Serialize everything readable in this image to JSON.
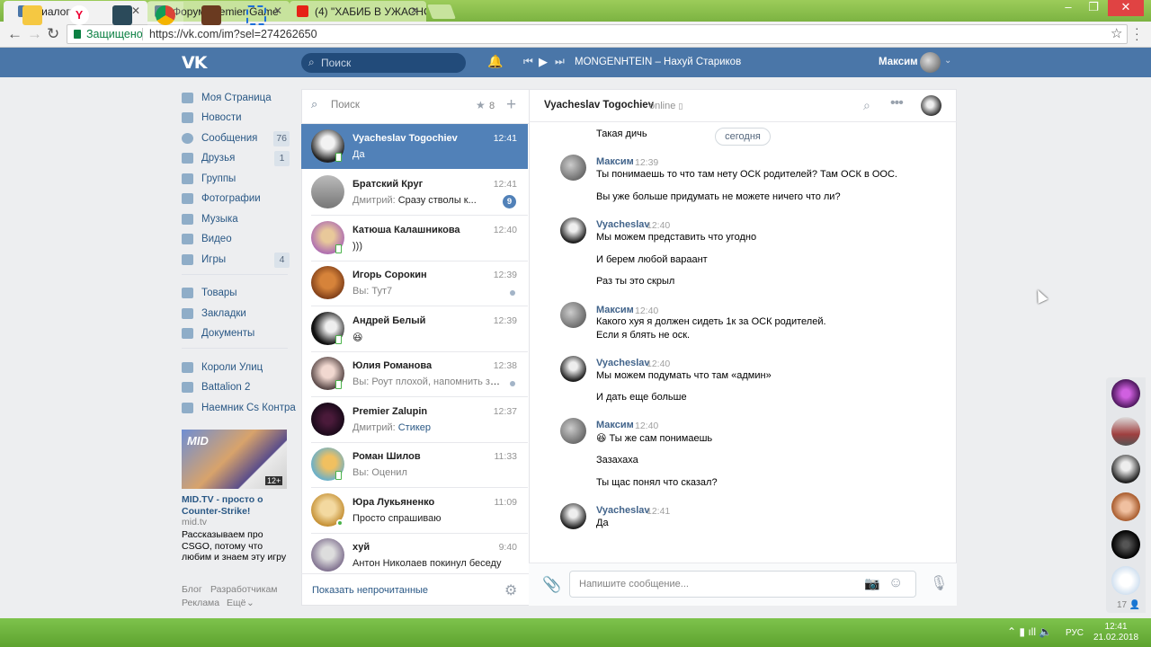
{
  "browser": {
    "tabs": [
      {
        "title": "Диалоги",
        "active": true,
        "icon": "vk-favicon"
      },
      {
        "title": "Форум Premier Game",
        "active": false,
        "icon": "forum-favicon"
      },
      {
        "title": "(4) \"ХАБИБ В УЖАСНОЙ",
        "active": false,
        "icon": "youtube-favicon"
      }
    ],
    "secure_label": "Защищено",
    "url": "https://vk.com/im?sel=274262650"
  },
  "header": {
    "logo": "VK",
    "search_placeholder": "Поиск",
    "track": "MONGENHTEIN – Нахуй Стариков",
    "user_name": "Максим"
  },
  "left_menu": {
    "items": [
      {
        "label": "Моя Страница",
        "count": ""
      },
      {
        "label": "Новости",
        "count": ""
      },
      {
        "label": "Сообщения",
        "count": "76"
      },
      {
        "label": "Друзья",
        "count": "1"
      },
      {
        "label": "Группы",
        "count": ""
      },
      {
        "label": "Фотографии",
        "count": ""
      },
      {
        "label": "Музыка",
        "count": ""
      },
      {
        "label": "Видео",
        "count": ""
      },
      {
        "label": "Игры",
        "count": "4"
      }
    ],
    "items2": [
      {
        "label": "Товары"
      },
      {
        "label": "Закладки"
      },
      {
        "label": "Документы"
      }
    ],
    "apps": [
      {
        "label": "Короли Улиц"
      },
      {
        "label": "Battalion 2"
      },
      {
        "label": "Наемник Cs Контра"
      }
    ],
    "ad": {
      "logo": "MID",
      "age": "12+",
      "title": "MID.TV - просто о Counter-Strike!",
      "site": "mid.tv",
      "desc": "Рассказываем про CSGO, потому что любим и знаем эту игру"
    },
    "footer": {
      "blog": "Блог",
      "dev": "Разработчикам",
      "ads": "Реклама",
      "more": "Ещё"
    }
  },
  "dialogs": {
    "search_placeholder": "Поиск",
    "starred_count": "8",
    "conversations": [
      {
        "name": "Vyacheslav Togochiev",
        "time": "12:41",
        "who": "",
        "preview": "Да",
        "badge": "",
        "dot": false,
        "selected": true
      },
      {
        "name": "Братский Круг",
        "time": "12:41",
        "who": "Дмитрий:",
        "preview": "Сразу стволы к...",
        "badge": "9",
        "dot": false,
        "selected": false
      },
      {
        "name": "Катюша Калашникова",
        "time": "12:40",
        "who": "",
        "preview": ")))",
        "badge": "",
        "dot": false,
        "selected": false
      },
      {
        "name": "Игорь Сорокин",
        "time": "12:39",
        "who": "Вы:",
        "preview": "Тут7",
        "badge": "",
        "dot": true,
        "selected": false
      },
      {
        "name": "Андрей Белый",
        "time": "12:39",
        "who": "",
        "preview": "😆",
        "badge": "",
        "dot": false,
        "selected": false
      },
      {
        "name": "Юлия Романова",
        "time": "12:38",
        "who": "Вы:",
        "preview": "Роут плохой, напомнить забыл.",
        "badge": "",
        "dot": true,
        "selected": false
      },
      {
        "name": "Premier Zalupin",
        "time": "12:37",
        "who": "Дмитрий:",
        "preview": "Стикер",
        "badge": "",
        "dot": false,
        "selected": false
      },
      {
        "name": "Роман Шилов",
        "time": "11:33",
        "who": "Вы:",
        "preview": "Оценил",
        "badge": "",
        "dot": false,
        "selected": false
      },
      {
        "name": "Юра Лукьяненко",
        "time": "11:09",
        "who": "",
        "preview": "Просто спрашиваю",
        "badge": "",
        "dot": false,
        "selected": false
      },
      {
        "name": "хуй",
        "time": "9:40",
        "who": "",
        "preview": "Антон Николаев покинул беседу",
        "badge": "",
        "dot": false,
        "selected": false
      }
    ],
    "show_unread": "Показать непрочитанные"
  },
  "chat": {
    "peer": "Vyacheslav Togochiev",
    "status": "online",
    "date_label": "сегодня",
    "top_text": "Такая дичь",
    "messages": [
      {
        "sender": "Максим",
        "time": "12:39",
        "lines": [
          "Ты понимаешь то что там нету ОСК родителей? Там ОСК в ООС.",
          "Вы уже больше придумать не можете ничего что ли?"
        ]
      },
      {
        "sender": "Vyacheslav",
        "time": "12:40",
        "lines": [
          "Мы можем представить что угодно",
          "И берем любой вараант",
          "Раз ты это скрыл"
        ]
      },
      {
        "sender": "Максим",
        "time": "12:40",
        "lines": [
          "Какого хуя я должен сидеть 1к за ОСК родителей.",
          "Если я блять не оск."
        ]
      },
      {
        "sender": "Vyacheslav",
        "time": "12:40",
        "lines": [
          "Мы можем подумать что там «админ»",
          "И дать еще больше"
        ]
      },
      {
        "sender": "Максим",
        "time": "12:40",
        "lines": [
          "😆 Ты же сам понимаешь",
          "Зазахаха",
          "Ты щас понял что сказал?"
        ]
      },
      {
        "sender": "Vyacheslav",
        "time": "12:41",
        "lines": [
          "Да"
        ]
      }
    ],
    "input_placeholder": "Напишите сообщение..."
  },
  "right_bar": {
    "count": "17"
  },
  "taskbar": {
    "lang": "РУС",
    "time": "12:41",
    "date": "21.02.2018"
  },
  "colors": {
    "vk_blue": "#4a76a8",
    "selected": "#5181b8",
    "link": "#2a5885",
    "chrome_green": "#7cb342"
  }
}
